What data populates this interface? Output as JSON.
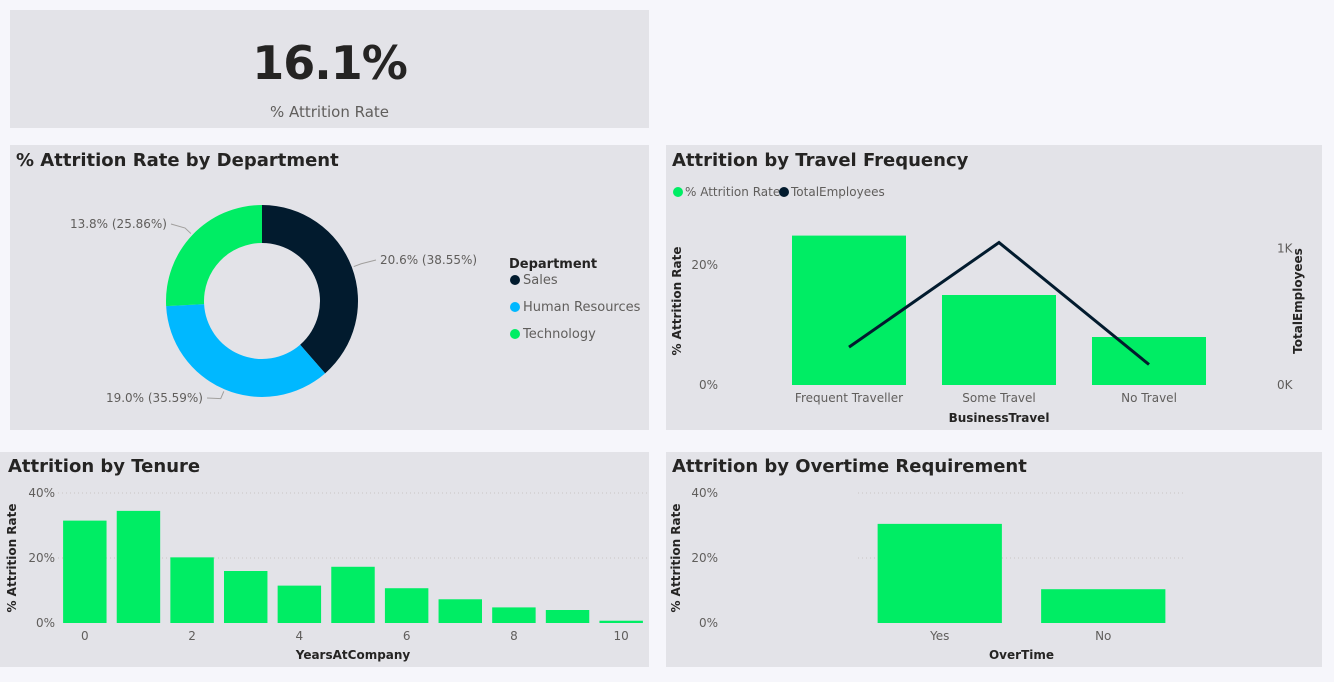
{
  "colors": {
    "green": "#00ed64",
    "navy": "#021b2e",
    "blue": "#00b8ff",
    "grid": "#c8c6c4"
  },
  "kpi": {
    "value": "16.1%",
    "label": "% Attrition Rate"
  },
  "chart_data": [
    {
      "id": "department",
      "type": "pie",
      "title": "% Attrition Rate by Department",
      "legend_title": "Department",
      "legend_position": "right",
      "slices": [
        {
          "name": "Sales",
          "value": 20.6,
          "share": 38.55,
          "label": "20.6% (38.55%)",
          "color": "#021b2e"
        },
        {
          "name": "Human Resources",
          "value": 19.0,
          "share": 35.59,
          "label": "19.0% (35.59%)",
          "color": "#00b8ff"
        },
        {
          "name": "Technology",
          "value": 13.8,
          "share": 25.86,
          "label": "13.8% (25.86%)",
          "color": "#00ed64"
        }
      ]
    },
    {
      "id": "travel",
      "type": "bar",
      "title": "Attrition by Travel Frequency",
      "xlabel": "BusinessTravel",
      "ylabel": "% Attrition Rate",
      "y2label": "TotalEmployees",
      "categories": [
        "Frequent Traveller",
        "Some Travel",
        "No Travel"
      ],
      "series": [
        {
          "name": "% Attrition Rate",
          "kind": "bar",
          "values": [
            24.9,
            15.0,
            8.0
          ],
          "color": "#00ed64"
        },
        {
          "name": "TotalEmployees",
          "kind": "line",
          "values": [
            277,
            1043,
            150
          ],
          "color": "#021b2e"
        }
      ],
      "ylim": [
        0,
        28
      ],
      "yticks": [
        0,
        20
      ],
      "ytick_labels": [
        "0%",
        "20%"
      ],
      "y2lim": [
        0,
        1230
      ],
      "y2ticks": [
        0,
        1000
      ],
      "y2tick_labels": [
        "0K",
        "1K"
      ],
      "legend_position": "top-left"
    },
    {
      "id": "tenure",
      "type": "bar",
      "title": "Attrition by Tenure",
      "xlabel": "YearsAtCompany",
      "ylabel": "% Attrition Rate",
      "categories": [
        0,
        1,
        2,
        3,
        4,
        5,
        6,
        7,
        8,
        9,
        10
      ],
      "values": [
        31.5,
        34.5,
        20.2,
        16.0,
        11.5,
        17.3,
        10.7,
        7.3,
        4.8,
        4.0,
        0.7
      ],
      "xtick_labels": [
        "0",
        "",
        "2",
        "",
        "4",
        "",
        "6",
        "",
        "8",
        "",
        "10"
      ],
      "ylim": [
        0,
        40
      ],
      "yticks": [
        0,
        20,
        40
      ],
      "ytick_labels": [
        "0%",
        "20%",
        "40%"
      ],
      "grid": true
    },
    {
      "id": "overtime",
      "type": "bar",
      "title": "Attrition by Overtime Requirement",
      "xlabel": "OverTime",
      "ylabel": "% Attrition Rate",
      "categories": [
        "Yes",
        "No"
      ],
      "values": [
        30.5,
        10.4
      ],
      "ylim": [
        0,
        40
      ],
      "yticks": [
        0,
        20,
        40
      ],
      "ytick_labels": [
        "0%",
        "20%",
        "40%"
      ],
      "grid": true
    }
  ]
}
